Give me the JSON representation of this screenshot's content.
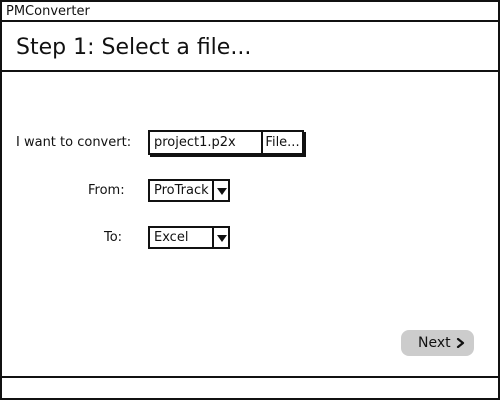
{
  "window": {
    "title": "PMConverter"
  },
  "header": {
    "title": "Step 1: Select a file..."
  },
  "form": {
    "convert_label": "I want to convert:",
    "file_value": "project1.p2x",
    "file_button_label": "File...",
    "from_label": "From:",
    "from_selected": "ProTrack",
    "to_label": "To:",
    "to_selected": "Excel"
  },
  "footer": {
    "next_label": "Next",
    "next_icon": "chevron-right-icon"
  },
  "colors": {
    "border": "#111111",
    "background": "#ffffff",
    "next_button_bg": "#cccccc"
  }
}
